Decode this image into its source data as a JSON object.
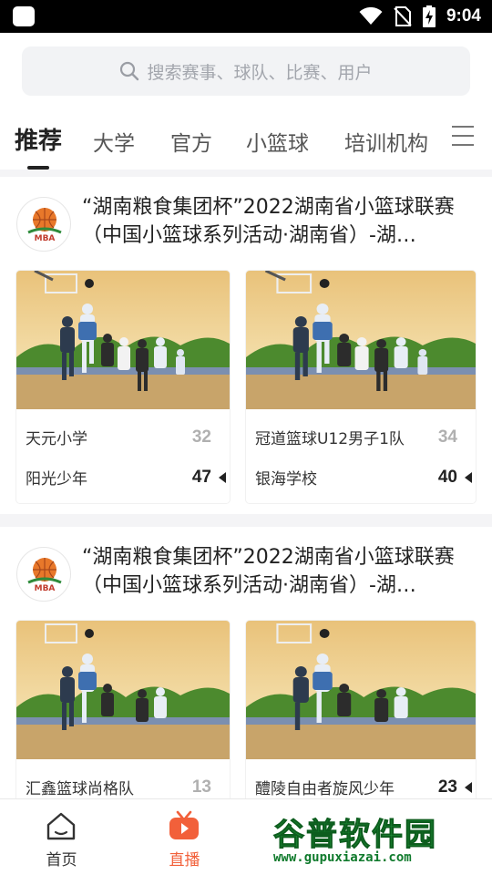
{
  "status_bar": {
    "time": "9:04"
  },
  "search": {
    "placeholder": "搜索赛事、球队、比赛、用户"
  },
  "tabs": [
    {
      "label": "推荐",
      "active": true
    },
    {
      "label": "大学"
    },
    {
      "label": "官方"
    },
    {
      "label": "小篮球"
    },
    {
      "label": "培训机构"
    }
  ],
  "feed": [
    {
      "title": "“湖南粮食集团杯”2022湖南省小篮球联赛（中国小篮球系列活动·湖南省）-湖…",
      "logo_text": "MBA",
      "matches": [
        {
          "home": {
            "name": "天元小学",
            "score": "32"
          },
          "away": {
            "name": "阳光少年",
            "score": "47"
          },
          "winner": "away"
        },
        {
          "home": {
            "name": "冠道篮球U12男子1队",
            "score": "34"
          },
          "away": {
            "name": "银海学校",
            "score": "40"
          },
          "winner": "away"
        }
      ]
    },
    {
      "title": "“湖南粮食集团杯”2022湖南省小篮球联赛（中国小篮球系列活动·湖南省）-湖…",
      "logo_text": "MBA",
      "matches": [
        {
          "home": {
            "name": "汇鑫篮球尚格队",
            "score": "13"
          },
          "away": {
            "name": "",
            "score": ""
          },
          "winner": "away"
        },
        {
          "home": {
            "name": "醴陵自由者旋风少年",
            "score": "23"
          },
          "away": {
            "name": "",
            "score": ""
          },
          "winner": "home"
        }
      ]
    }
  ],
  "bottom_nav": [
    {
      "label": "首页",
      "icon": "home-icon"
    },
    {
      "label": "直播",
      "icon": "live-tv-icon",
      "active": true
    }
  ],
  "watermark": {
    "text": "谷普软件园",
    "url": "www.gupuxiazai.com"
  },
  "colors": {
    "accent": "#f2603a",
    "win_score": "#222222",
    "lose_score": "#b0b0b0"
  }
}
